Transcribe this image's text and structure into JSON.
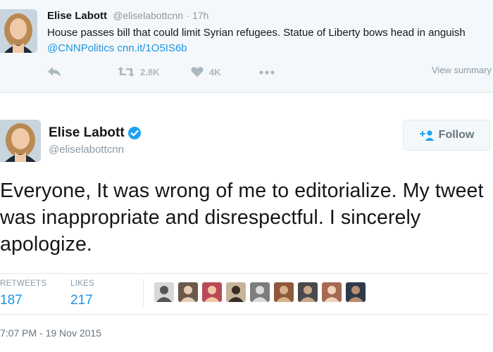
{
  "context_tweet": {
    "name": "Elise Labott",
    "handle": "@eliselabottcnn",
    "separator": "·",
    "time": "17h",
    "text_start": "House passes bill that could limit Syrian refugees. Statue of Liberty bows head in anguish ",
    "mention": "@CNNPolitics",
    "url": "cnn.it/1O5IS6b",
    "retweet_count": "2.8K",
    "like_count": "4K",
    "view_summary": "View summary"
  },
  "main_tweet": {
    "name": "Elise Labott",
    "handle": "@eliselabottcnn",
    "follow_label": "Follow",
    "text": "Everyone, It was wrong of me to editorialize. My tweet was inappropriate and disrespectful. I sincerely apologize.",
    "retweets_label": "RETWEETS",
    "retweets_value": "187",
    "likes_label": "LIKES",
    "likes_value": "217",
    "timestamp": "7:07 PM - 19 Nov 2015"
  },
  "colors": {
    "link": "#1b95e0",
    "muted": "#8899a6",
    "context_bg": "#f5f8fa",
    "verified": "#1da1f2"
  },
  "likers": [
    {
      "icon": "user-avatar-1",
      "bg": "#d8d8d8",
      "fg": "#555555"
    },
    {
      "icon": "user-avatar-2",
      "bg": "#6b5a4a",
      "fg": "#e6cdb4"
    },
    {
      "icon": "user-avatar-3",
      "bg": "#b84b56",
      "fg": "#f2c7a7"
    },
    {
      "icon": "user-avatar-4",
      "bg": "#c7b49c",
      "fg": "#3b2d22"
    },
    {
      "icon": "user-avatar-5",
      "bg": "#7d7d7d",
      "fg": "#dcdcdc"
    },
    {
      "icon": "user-avatar-6",
      "bg": "#8e5a3a",
      "fg": "#d9b08c"
    },
    {
      "icon": "user-avatar-7",
      "bg": "#4a4a4a",
      "fg": "#c9a98a"
    },
    {
      "icon": "user-avatar-8",
      "bg": "#a56a52",
      "fg": "#f0d2b8"
    },
    {
      "icon": "user-avatar-9",
      "bg": "#2e3a4a",
      "fg": "#b78e72"
    }
  ]
}
